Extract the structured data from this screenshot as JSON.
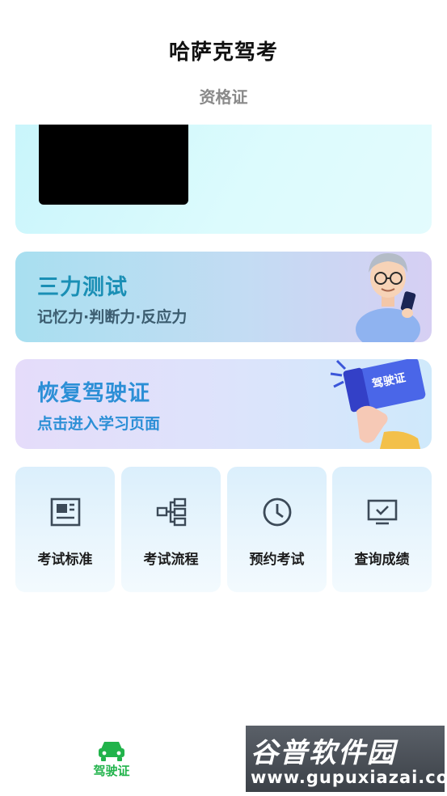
{
  "header": {
    "title": "哈萨克驾考",
    "subtitle": "资格证"
  },
  "cards": [
    {
      "title": "三力测试",
      "subtitle": "记忆力·判断力·反应力",
      "illustration": "person-with-phone"
    },
    {
      "title": "恢复驾驶证",
      "subtitle": "点击进入学习页面",
      "illustration": "license-card-hand",
      "badge": "驾驶证"
    }
  ],
  "tiles": [
    {
      "label": "考试标准",
      "icon": "document-icon"
    },
    {
      "label": "考试流程",
      "icon": "flowchart-icon"
    },
    {
      "label": "预约考试",
      "icon": "clock-icon"
    },
    {
      "label": "查询成绩",
      "icon": "monitor-check-icon"
    }
  ],
  "tabbar": {
    "active_label": "驾驶证",
    "active_color": "#21b34b"
  },
  "watermark": {
    "title": "谷普软件园",
    "url": "www.gupuxiazai.com"
  },
  "colors": {
    "accent_blue": "#2c8fd6",
    "teal": "#1a8fb5",
    "icon_gray": "#3c4a58"
  }
}
